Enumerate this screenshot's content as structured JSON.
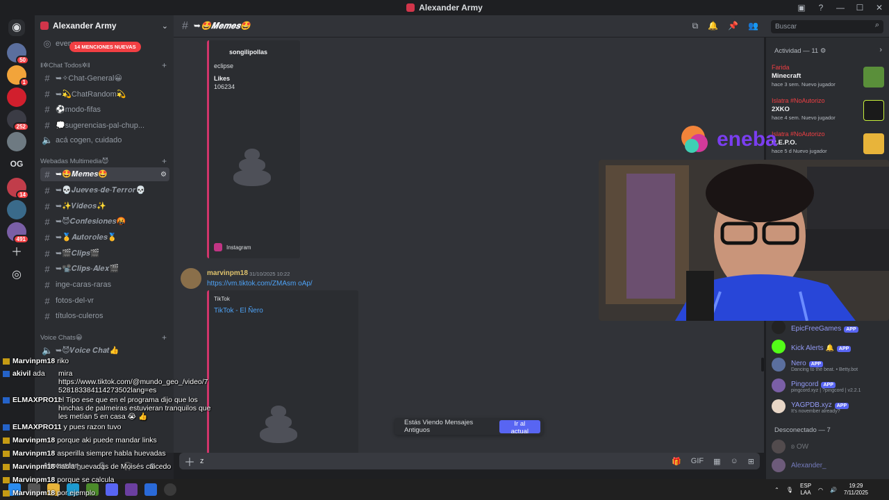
{
  "window": {
    "title": "Alexander Army"
  },
  "servers": [
    {
      "badge": "50"
    },
    {
      "badge": "1"
    },
    {
      "badge": ""
    },
    {
      "badge": "252"
    },
    {
      "badge": ""
    },
    {
      "label": "OG"
    },
    {
      "badge": "14"
    },
    {
      "badge": ""
    },
    {
      "badge": "491"
    }
  ],
  "sidebar": {
    "server_name": "Alexander Army",
    "events_label": "even",
    "mentions_pill": "14 MENCIONES NUEVAS",
    "categories": {
      "chat_todos": "‖✲Chat Todos✲‖",
      "webadas": "Webadas Multimedia😈",
      "voice": "Voice Chats😀"
    },
    "channels": {
      "chat_general": "➥✧Chat-General😀",
      "chat_random": "➥💫ChatRandom💫",
      "modo_fifas": "⚽modo-fifas",
      "sugerencias": "💭sugerencias-pal-chup...",
      "aca_cogen": "acá cogen, cuidado",
      "memes": "➥🤩𝑴𝒆𝒎𝒆𝒔🤩",
      "jueves": "➥💀𝑱𝒖𝒆𝒗𝒆𝒔-𝒅𝒆-𝑻𝒆𝒓𝒓𝒐𝒓💀",
      "videos": "➥✨𝑽𝒊𝒅𝒆𝒐𝒔✨",
      "confesiones": "➥😈𝑪𝒐𝒏𝒇𝒆𝒔𝒊𝒐𝒏𝒆𝒔🤬",
      "autoroles": "➥🥇𝑨𝒖𝒕𝒐𝒓𝒐𝒍𝒆𝒔🥇",
      "clips": "➥🎬𝑪𝒍𝒊𝒑𝒔🎬",
      "clips_alex": "➥📽️𝑪𝒍𝒊𝒑𝒔-𝑨𝒍𝒆𝒙🎬",
      "inge_caras": "inge-caras-raras",
      "fotos": "fotos-del-vr",
      "titulos": "títulos-culeros",
      "voice_chat": "➥😈𝑽𝒐𝒊𝒄𝒆 𝑪𝒉𝒂𝒕👍"
    },
    "user": "Alexander_"
  },
  "chat_header": {
    "channel": "➥🤩𝑴𝒆𝒎𝒆𝒔🤩"
  },
  "search": {
    "placeholder": "Buscar"
  },
  "messages": {
    "embed1": {
      "author": "songilipollas",
      "line1": "eclipse",
      "likes_label": "Likes",
      "likes": "106234",
      "footer": "Instagram"
    },
    "msg2": {
      "author": "marvinpm18",
      "time": "31/10/2025 10:22",
      "link": "https://vm.tiktok.com/ZMAsm  oAp/",
      "provider": "TikTok",
      "title": "TikTok - El Ñero"
    }
  },
  "old_messages": {
    "text": "Estás Viendo Mensajes Antiguos",
    "button": "Ir al actual"
  },
  "composer": {
    "value": "z"
  },
  "right_panel": {
    "activity_header": "Actividad — 11 ⚙",
    "activities": [
      {
        "who": "Farida",
        "game": "Minecraft",
        "meta": "hace 3 sem.   Nuevo jugador"
      },
      {
        "who": "Islatra #NoAutorizo",
        "game": "2XKO",
        "meta": "hace 4 sem.   Nuevo jugador"
      },
      {
        "who": "Islatra #NoAutorizo",
        "game": "R.E.P.O.",
        "meta": "hace 5 d   Nuevo jugador"
      }
    ],
    "members": [
      {
        "name": "EpicFreeGames",
        "app": "APP",
        "sub": ""
      },
      {
        "name": "Kick Alerts 🔔",
        "app": "APP",
        "sub": ""
      },
      {
        "name": "Nero",
        "app": "APP",
        "sub": "Dancing to the beat. • Betty.bot"
      },
      {
        "name": "Pingcord",
        "app": "APP",
        "sub": "pingcord.xyz | ?pingcord | v2.2.1"
      },
      {
        "name": "YAGPDB.xyz",
        "app": "APP",
        "sub": "It's november already?"
      }
    ],
    "offline_header": "Desconectado — 7",
    "offline": [
      {
        "name": "ʚ OW"
      },
      {
        "name": "Alexander_"
      }
    ]
  },
  "overlay_logo": "eneba",
  "stream_chat": [
    {
      "user": "Marvinpm18",
      "msg": "riko"
    },
    {
      "user": "akivil",
      "msg": "ada"
    },
    {
      "user": "",
      "msg": "mira https://www.tiktok.com/@mundo_geo_/video/7 528183384114273502lang=es"
    },
    {
      "user": "ELMAXPRO11",
      "msg": "el Tipo ese que en el programa dijo que los hinchas de palmeiras estuvieran tranquilos que les metían 5 en casa 😭 👍"
    },
    {
      "user": "ELMAXPRO11",
      "msg": "y pues razon tuvo"
    },
    {
      "user": "Marvinpm18",
      "msg": "porque aki puede mandar links"
    },
    {
      "user": "Marvinpm18",
      "msg": "asperilla siempre habla huevadas"
    },
    {
      "user": "Marvinpm18",
      "msg": "habla huevadas de Moisés caicedo"
    },
    {
      "user": "Marvinpm18",
      "msg": "porque se calcula"
    },
    {
      "user": "Marvinpm18",
      "msg": "por ejemplo"
    }
  ],
  "taskbar": {
    "lang1": "ESP",
    "lang2": "LAA",
    "time": "19:29",
    "date": "7/11/2025"
  }
}
